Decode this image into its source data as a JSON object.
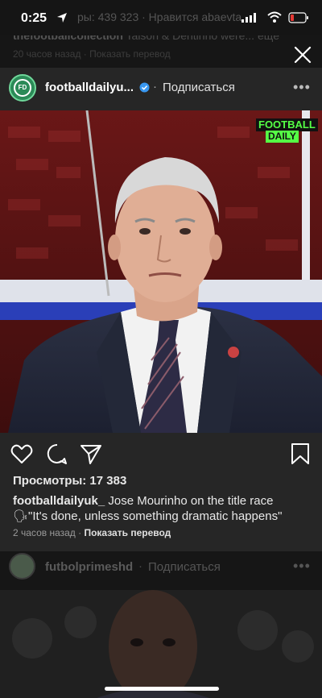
{
  "status_bar": {
    "time": "0:25",
    "icons": [
      "location-arrow-icon",
      "signal-icon",
      "wifi-icon",
      "battery-icon"
    ]
  },
  "background_feed": {
    "views_partial": "ры: 439 323 · Нравится abaevta",
    "caption_user": "thefootballcollection",
    "caption_text": " Taison & Dentinho were... ещё",
    "meta": "20 часов назад · Показать перевод"
  },
  "post": {
    "username": "footballdailyu...",
    "verified": true,
    "separator": "·",
    "follow_label": "Подписаться",
    "more_label": "•••",
    "media_badge_line1": "FOOTBALL",
    "media_badge_line2": "DAILY",
    "views": "Просмотры: 17 383",
    "caption_user": "footballdailyuk_",
    "caption_line1": " Jose Mourinho on the title race",
    "caption_line2": "\"It's done, unless something dramatic happens\"",
    "caption_emoji": "🗣",
    "time_ago": "2 часов назад",
    "meta_separator": " · ",
    "translate_label": "Показать перевод",
    "colors": {
      "accent_green": "#55ff45",
      "avatar_green": "#2b8a57",
      "verified_blue": "#3897f0"
    }
  },
  "next_post": {
    "username": "futbolprimeshd",
    "separator": "·",
    "follow_label": "Подписаться",
    "more_label": "•••"
  }
}
